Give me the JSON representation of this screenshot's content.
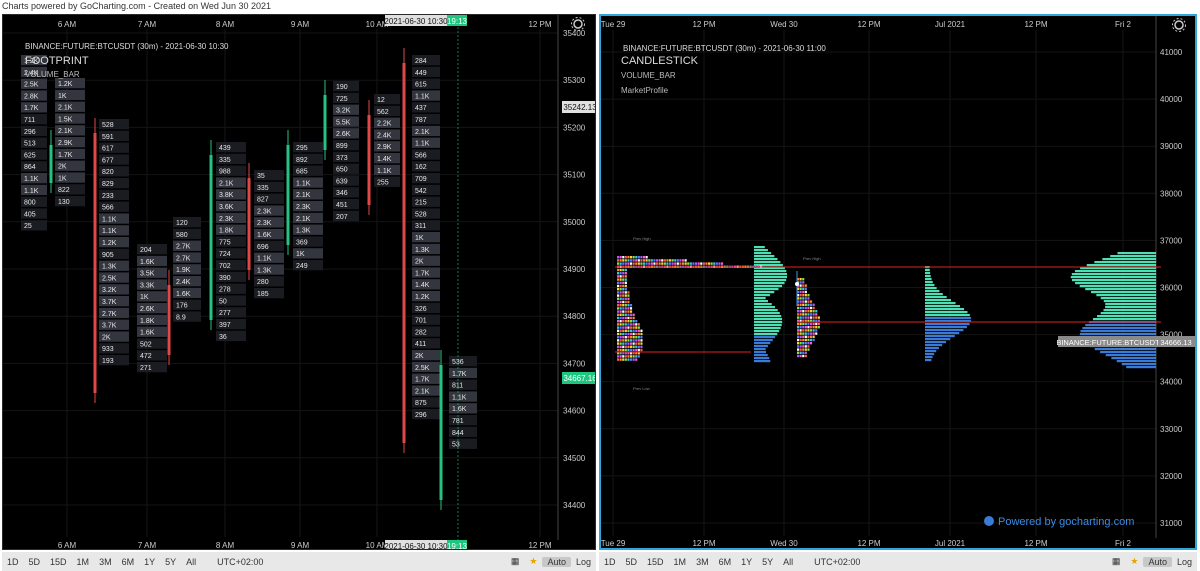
{
  "credit": "Charts powered by GoCharting.com - Created on Wed Jun 30 2021",
  "left": {
    "symbol": "BINANCE:FUTURE:BTCUSDT (30m) - 2021-06-30 10:30",
    "chart_type": "FOOTPRINT",
    "indicator": "VOLUME_BAR",
    "time_labels": [
      "6 AM",
      "7 AM",
      "8 AM",
      "9 AM",
      "10 AM",
      "12 PM"
    ],
    "price_labels": [
      "35400",
      "35300",
      "35200",
      "35100",
      "35000",
      "34900",
      "34800",
      "34700",
      "34600",
      "34500",
      "34400"
    ],
    "crosshair_time": "2021-06-30 10:30",
    "crosshair_countdown": "19:13",
    "price_tags": {
      "cross": "35242.13",
      "last": "34667.16"
    },
    "columns": [
      [
        "1.2K",
        "2.4K",
        "2.5K",
        "2.8K",
        "1.7K",
        "711",
        "296",
        "513",
        "625",
        "864",
        "1.1K",
        "1.1K",
        "800",
        "405",
        "25"
      ],
      [
        "1.2K",
        "1K",
        "2.1K",
        "1.5K",
        "2.1K",
        "2.9K",
        "1.7K",
        "2K",
        "1K",
        "822",
        "130"
      ],
      [
        "528",
        "591",
        "617",
        "677",
        "820",
        "829",
        "233",
        "566",
        "1.1K",
        "1.1K",
        "1.2K",
        "905",
        "1.3K",
        "2.5K",
        "3.2K",
        "3.7K",
        "2.7K",
        "3.7K",
        "2K",
        "933",
        "193"
      ],
      [
        "204",
        "1.6K",
        "3.5K",
        "3.3K",
        "1K",
        "2.6K",
        "1.8K",
        "1.6K",
        "502",
        "472",
        "271"
      ],
      [
        "120",
        "580",
        "2.7K",
        "2.7K",
        "1.9K",
        "2.4K",
        "1.6K",
        "176",
        "8.9"
      ],
      [
        "439",
        "335",
        "988",
        "2.1K",
        "3.8K",
        "3.6K",
        "2.3K",
        "1.8K",
        "775",
        "724",
        "702",
        "390",
        "278",
        "50",
        "277",
        "397",
        "36"
      ],
      [
        "35",
        "335",
        "827",
        "2.3K",
        "2.3K",
        "1.6K",
        "696",
        "1.1K",
        "1.3K",
        "280",
        "185"
      ],
      [
        "295",
        "892",
        "685",
        "1.1K",
        "2.1K",
        "2.3K",
        "2.1K",
        "1.3K",
        "369",
        "1K",
        "249"
      ],
      [
        "190",
        "725",
        "3.2K",
        "5.5K",
        "2.6K",
        "899",
        "373",
        "650",
        "639",
        "346",
        "451",
        "207"
      ],
      [
        "12",
        "562",
        "2.2K",
        "2.4K",
        "2.9K",
        "1.4K",
        "1.1K",
        "255"
      ],
      [
        "284",
        "449",
        "615",
        "1.1K",
        "437",
        "787",
        "2.1K",
        "1.1K",
        "566",
        "162",
        "709",
        "542",
        "215",
        "528",
        "311",
        "1K",
        "1.3K",
        "2K",
        "1.7K",
        "1.4K",
        "1.2K",
        "326",
        "701",
        "282",
        "411",
        "2K",
        "2.5K",
        "1.7K",
        "2.1K",
        "875",
        "296"
      ],
      [
        "536",
        "1.7K",
        "811",
        "1.1K",
        "1.6K",
        "781",
        "844",
        "53"
      ]
    ]
  },
  "right": {
    "symbol": "BINANCE:FUTURE:BTCUSDT (30m) - 2021-06-30 11:00",
    "chart_type": "CANDLESTICK",
    "indicator": "VOLUME_BAR",
    "indicator2": "MarketProfile",
    "time_labels": [
      "Tue 29",
      "12 PM",
      "Wed 30",
      "12 PM",
      "Jul 2021",
      "12 PM",
      "Fri 2"
    ],
    "price_labels": [
      "41000",
      "40000",
      "39000",
      "38000",
      "37000",
      "36000",
      "35000",
      "34000",
      "33000",
      "32000",
      "31000"
    ],
    "last_label": "BINANCE:FUTURE:BTCUSDT",
    "last_price": "34666.13",
    "powered": "Powered by gocharting.com",
    "mini_labels": {
      "high": "Prev High",
      "low": "Prev Low"
    }
  },
  "bottombar": {
    "ranges": [
      "1D",
      "5D",
      "15D",
      "1M",
      "3M",
      "6M",
      "1Y",
      "5Y",
      "All"
    ],
    "timezone": "UTC+02:00",
    "auto": "Auto",
    "log": "Log"
  },
  "colors": {
    "up": "#26c281",
    "down": "#e04848",
    "cell": "#3a3d48",
    "profile": "#4ee0b4",
    "profile_blue": "#3a7bd5",
    "poc_line": "#e02020",
    "tag_green": "#1ec77f",
    "tag_gray": "#e0e0e0"
  }
}
